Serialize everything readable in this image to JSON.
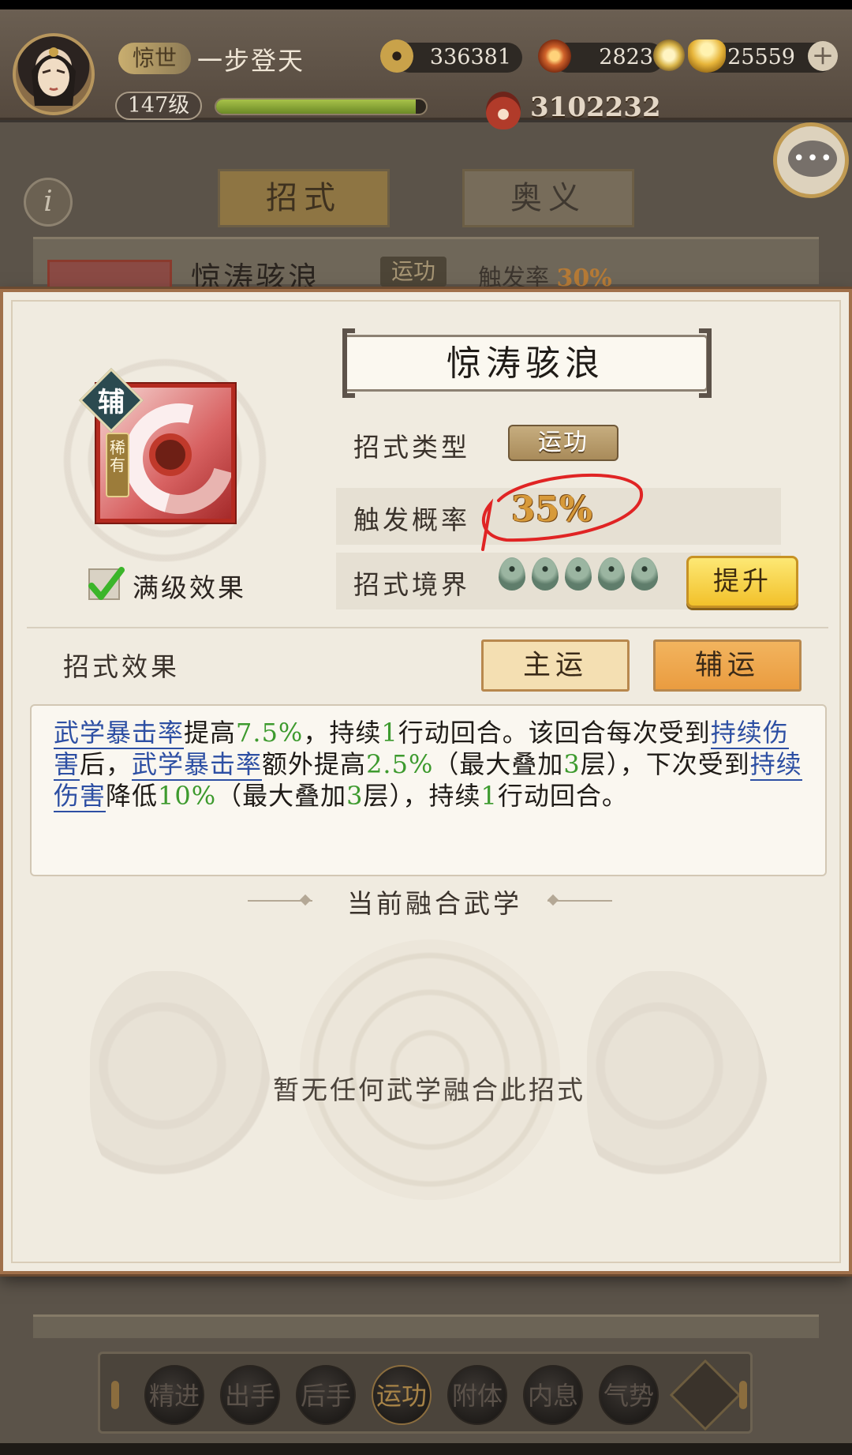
{
  "player": {
    "title_tag": "惊世",
    "name": "一步登天",
    "level": "147级",
    "exp_fraction": 0.95,
    "power": "3102232"
  },
  "currencies": [
    {
      "icon": "copper-coin-icon",
      "value": "336381"
    },
    {
      "icon": "flame-gem-icon",
      "value": "2823"
    },
    {
      "icon": "gold-ingot-icon",
      "value": "25559"
    }
  ],
  "background_page": {
    "tabs": [
      "招式",
      "奥义"
    ],
    "row": {
      "name": "惊涛骇浪",
      "type": "运功",
      "rate_label": "触发率",
      "rate_value": "30%"
    },
    "bottom_nav": [
      "精进",
      "出手",
      "后手",
      "运功",
      "附体",
      "内息",
      "气势"
    ],
    "bottom_nav_active": 3
  },
  "dialog": {
    "skill_name": "惊涛骇浪",
    "badge_fu": "辅",
    "rare_tag": "稀有",
    "max_effect_label": "满级效果",
    "max_effect_checked": true,
    "type_label": "招式类型",
    "type_value": "运功",
    "rate_label": "触发概率",
    "rate_value": "35%",
    "realm_label": "招式境界",
    "realm_level": 5,
    "upgrade_label": "提升",
    "effect_title": "招式效果",
    "tab_main": "主运",
    "tab_aux": "辅运",
    "description": {
      "p1": "武学暴击率",
      "p2": "提高",
      "p3": "7.5%",
      "p4": "，持续",
      "p5": "1",
      "p6": "行动回合。该回合每次受到",
      "p7": "持续伤害",
      "p8": "后，",
      "p9": "武学暴击率",
      "p10": "额外提高",
      "p11": "2.5%",
      "p12": "（最大叠加",
      "p13": "3",
      "p14": "层），下次受到",
      "p15": "持续伤害",
      "p16": "降低",
      "p17": "10%",
      "p18": "（最大叠加",
      "p19": "3",
      "p20": "层），持续",
      "p21": "1",
      "p22": "行动回合。"
    },
    "fusion_title": "当前融合武学",
    "fusion_empty": "暂无任何武学融合此招式"
  },
  "colors": {
    "keyword": "#2d4fa3",
    "number": "#3d9a2e",
    "rate": "#d79a3a",
    "annotation_circle": "#e02424"
  }
}
